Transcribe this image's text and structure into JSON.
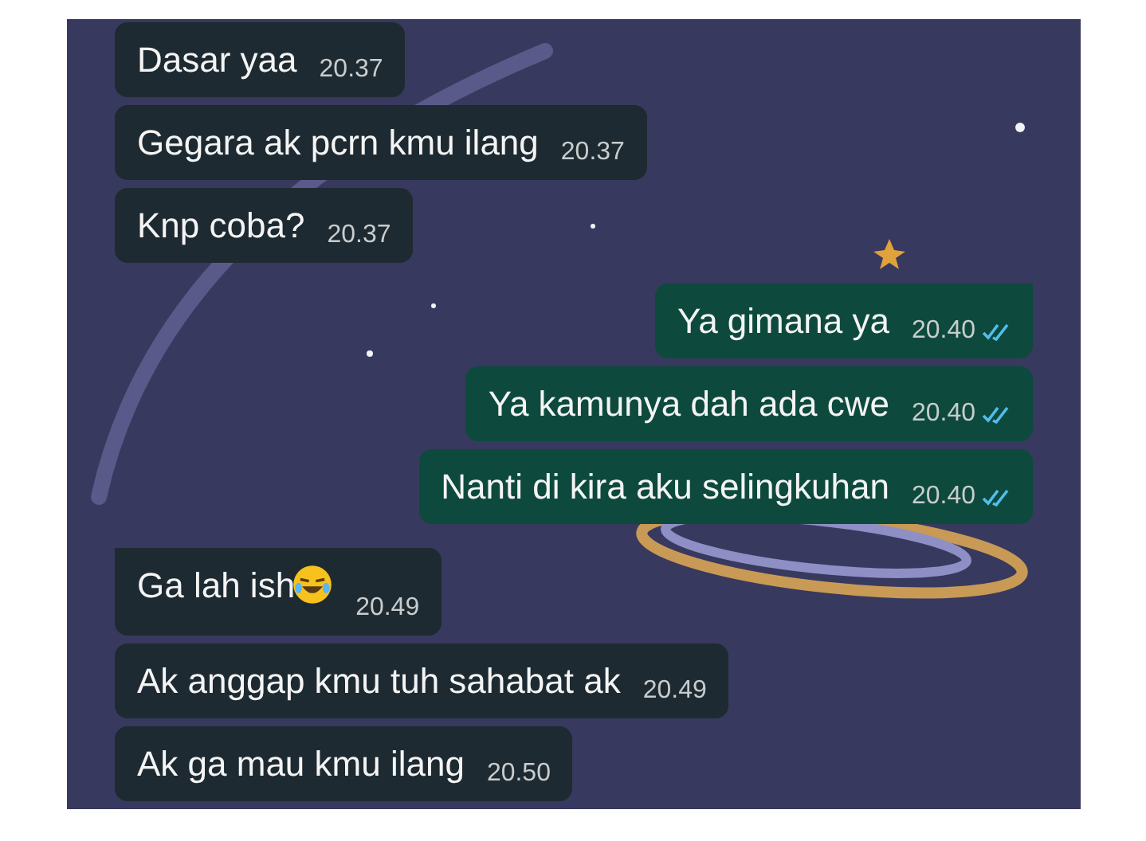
{
  "messages": [
    {
      "kind": "in",
      "text": "Dasar yaa",
      "time": "20.37",
      "tail": false,
      "emoji": false
    },
    {
      "kind": "in",
      "text": "Gegara ak pcrn kmu ilang",
      "time": "20.37",
      "tail": false,
      "emoji": false
    },
    {
      "kind": "in",
      "text": "Knp coba?",
      "time": "20.37",
      "tail": false,
      "emoji": false
    },
    {
      "kind": "out",
      "text": "Ya gimana ya",
      "time": "20.40",
      "tail": true,
      "read": true
    },
    {
      "kind": "out",
      "text": "Ya kamunya dah ada cwe",
      "time": "20.40",
      "tail": false,
      "read": true
    },
    {
      "kind": "out",
      "text": "Nanti di kira aku selingkuhan",
      "time": "20.40",
      "tail": false,
      "read": true
    },
    {
      "kind": "in",
      "text": "Ga lah ish",
      "time": "20.49",
      "tail": true,
      "emoji": true
    },
    {
      "kind": "in",
      "text": "Ak anggap kmu tuh sahabat ak",
      "time": "20.49",
      "tail": false,
      "emoji": false
    },
    {
      "kind": "in",
      "text": "Ak ga mau kmu ilang",
      "time": "20.50",
      "tail": false,
      "emoji": false
    }
  ]
}
